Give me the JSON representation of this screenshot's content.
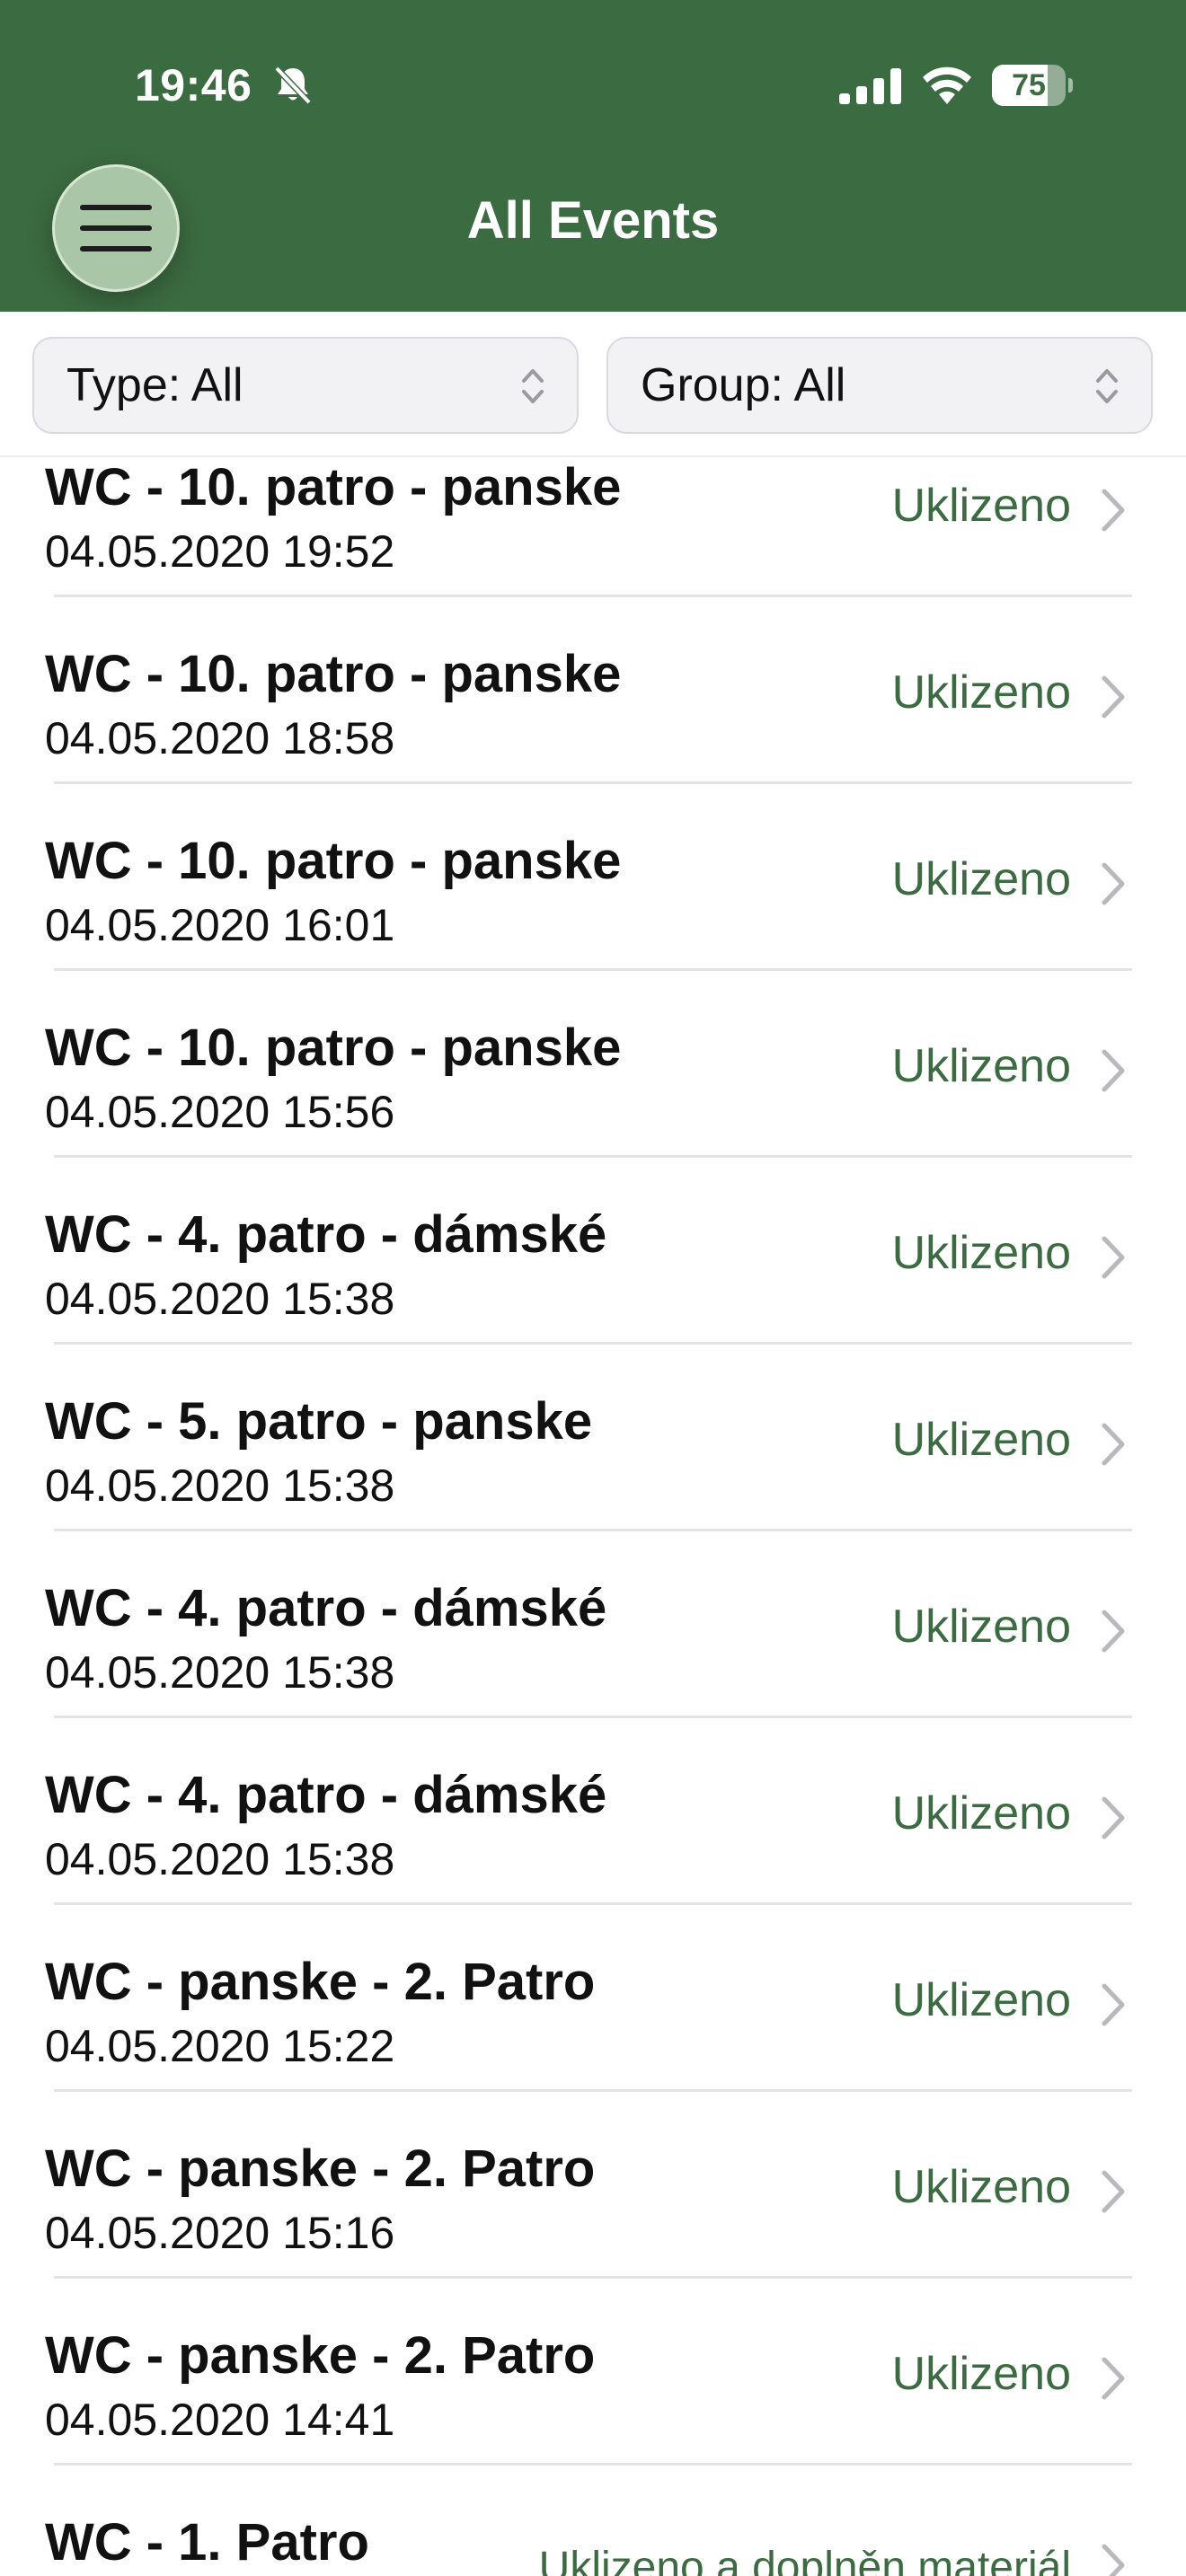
{
  "status_bar": {
    "time": "19:46",
    "battery": "75",
    "battery_level": 0.75,
    "icons": [
      "bell-slash-icon",
      "signal-icon",
      "wifi-icon",
      "battery-icon"
    ]
  },
  "header": {
    "title": "All Events",
    "menu_icon": "hamburger-menu-icon",
    "background": "#3b6b40"
  },
  "filters": {
    "type_label": "Type: All",
    "group_label": "Group: All"
  },
  "accent_color": "#3b6b40",
  "events": [
    {
      "title": "WC - 10. patro - panske",
      "date": "04.05.2020 19:52",
      "status": "Uklizeno"
    },
    {
      "title": "WC - 10. patro - panske",
      "date": "04.05.2020 18:58",
      "status": "Uklizeno"
    },
    {
      "title": "WC - 10. patro - panske",
      "date": "04.05.2020 16:01",
      "status": "Uklizeno"
    },
    {
      "title": "WC - 10. patro - panske",
      "date": "04.05.2020 15:56",
      "status": "Uklizeno"
    },
    {
      "title": "WC - 4. patro - dámské",
      "date": "04.05.2020 15:38",
      "status": "Uklizeno"
    },
    {
      "title": "WC - 5. patro - panske",
      "date": "04.05.2020 15:38",
      "status": "Uklizeno"
    },
    {
      "title": "WC - 4. patro - dámské",
      "date": "04.05.2020 15:38",
      "status": "Uklizeno"
    },
    {
      "title": "WC - 4. patro - dámské",
      "date": "04.05.2020 15:38",
      "status": "Uklizeno"
    },
    {
      "title": "WC - panske - 2. Patro",
      "date": "04.05.2020 15:22",
      "status": "Uklizeno"
    },
    {
      "title": "WC - panske - 2. Patro",
      "date": "04.05.2020 15:16",
      "status": "Uklizeno"
    },
    {
      "title": "WC - panske - 2. Patro",
      "date": "04.05.2020 14:41",
      "status": "Uklizeno"
    },
    {
      "title": "WC - 1. Patro",
      "date": "",
      "status": "Uklizeno a doplněn materiál"
    }
  ]
}
